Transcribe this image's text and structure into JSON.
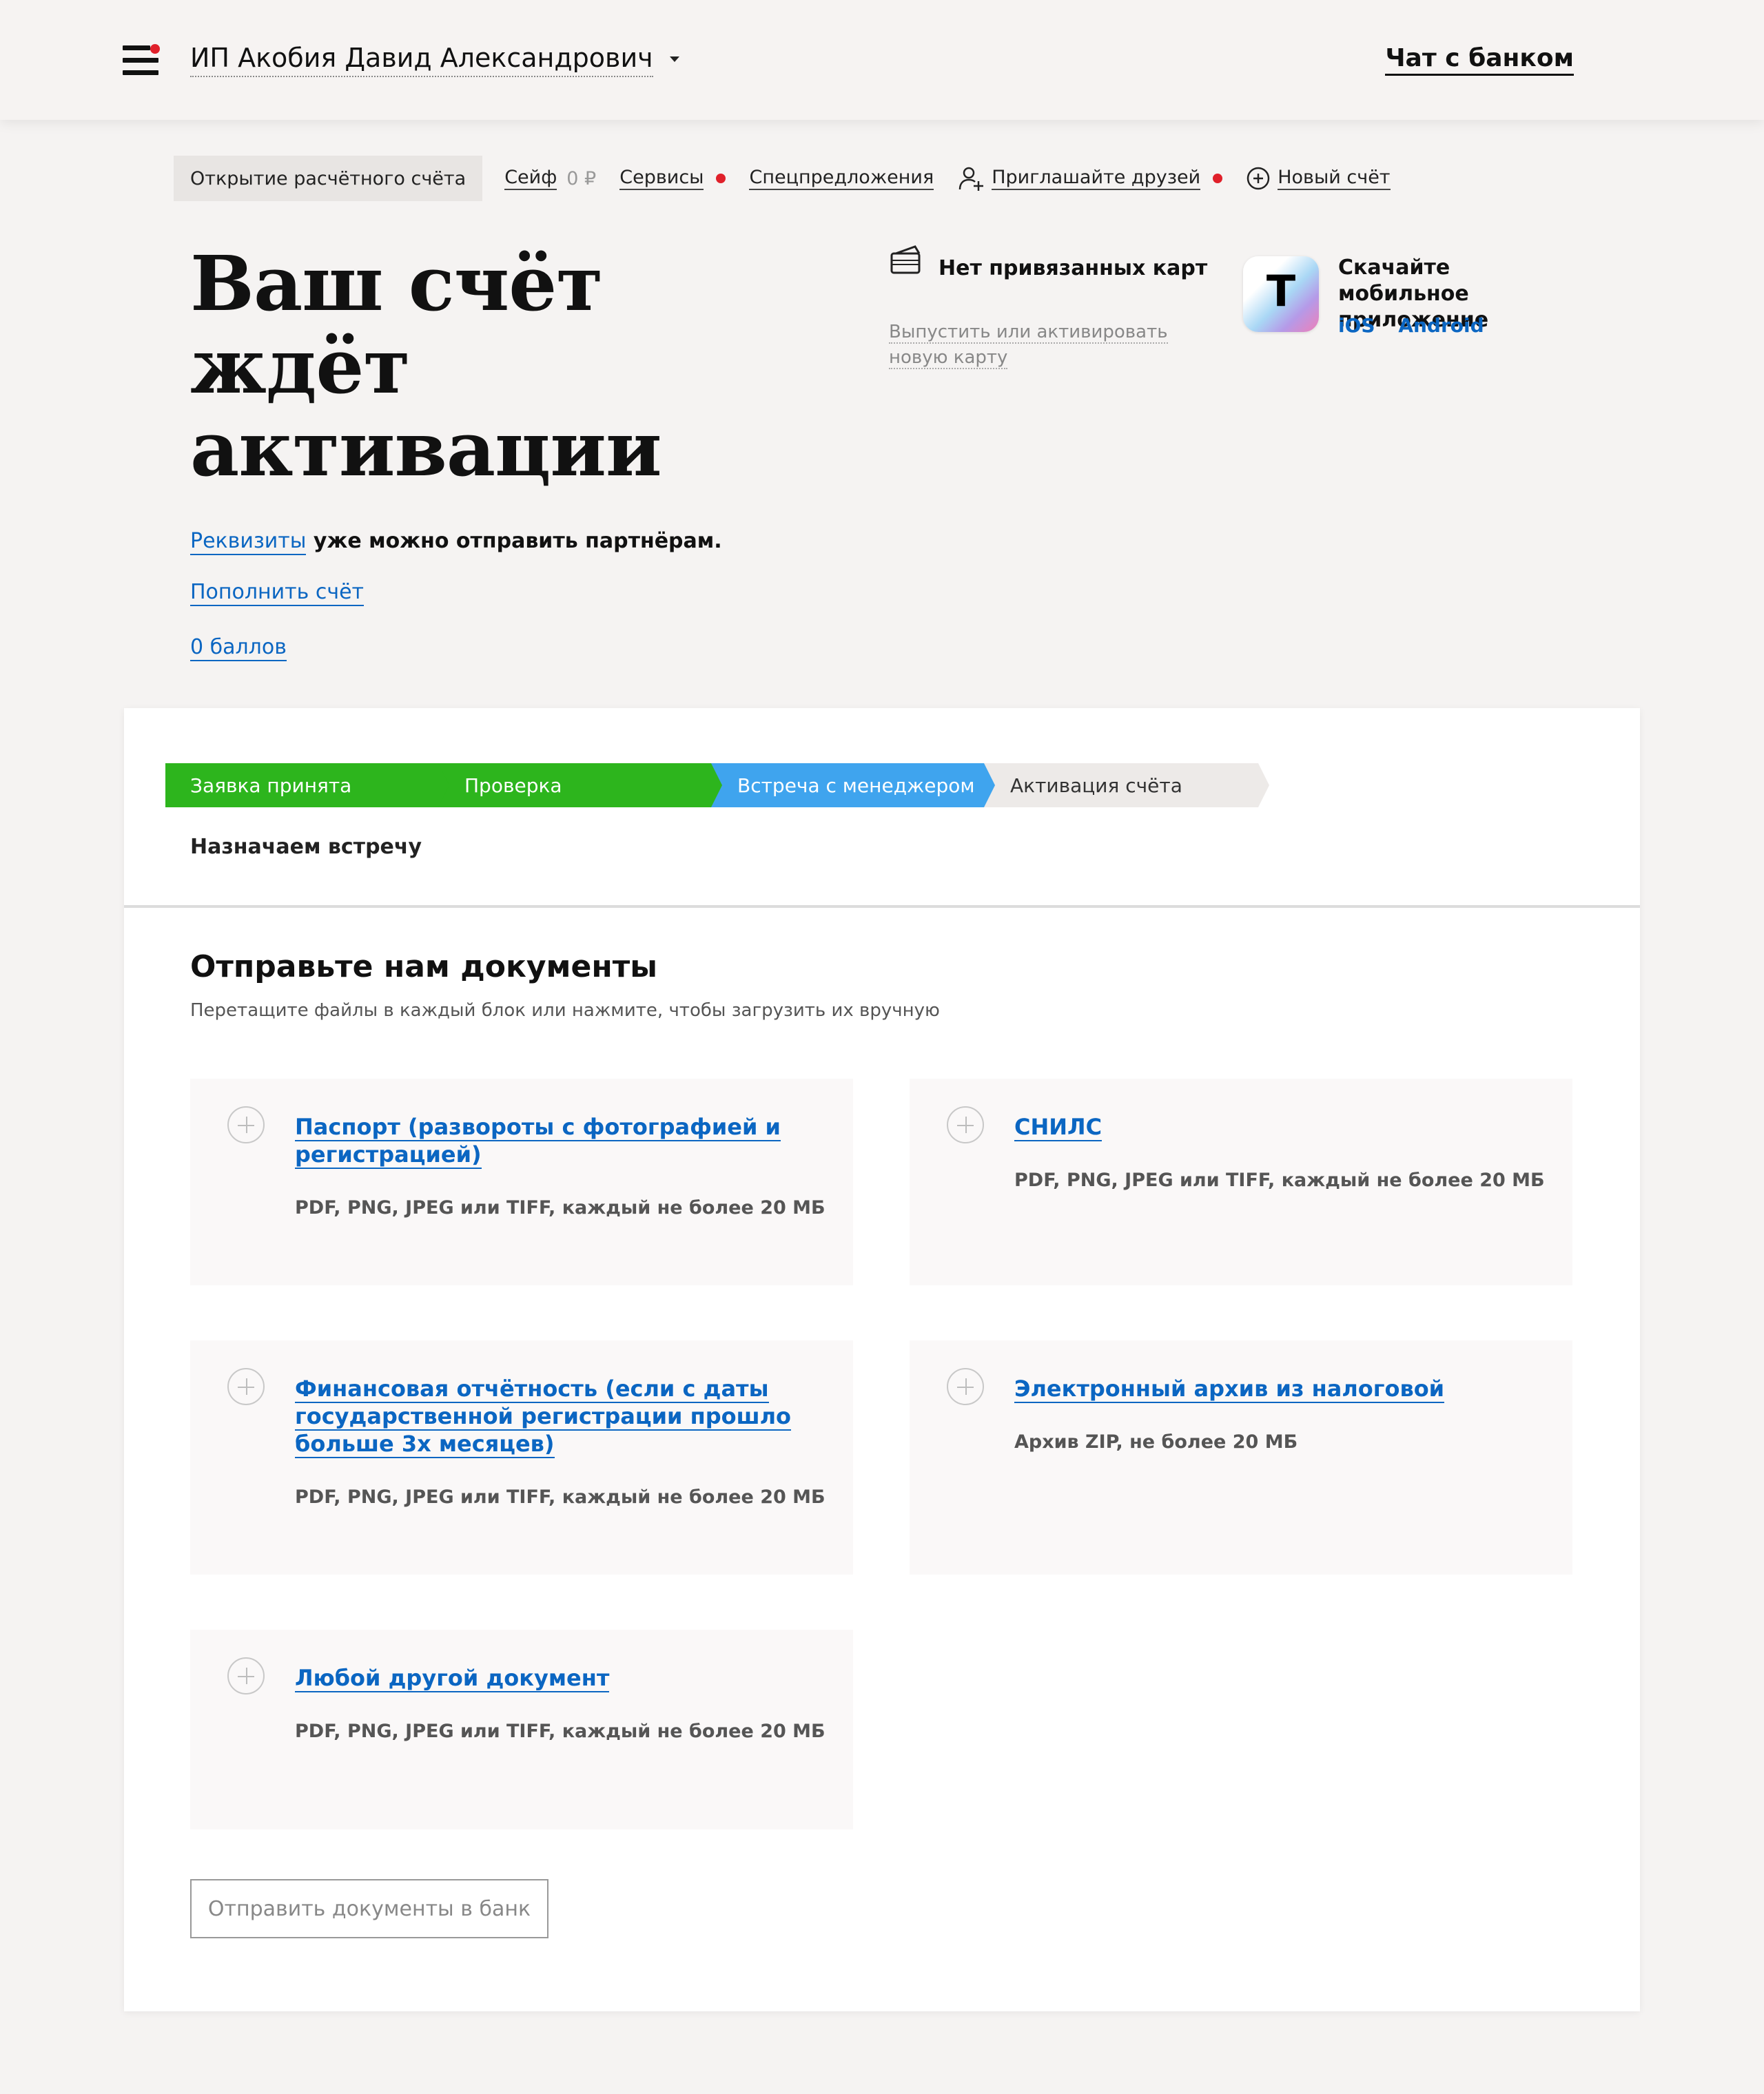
{
  "header": {
    "company": "ИП Акобия Давид Александрович",
    "chat": "Чат с банком"
  },
  "nav": {
    "items": [
      {
        "label": "Открытие расчётного счёта"
      },
      {
        "label": "Сейф",
        "extra": "0 ₽"
      },
      {
        "label": "Сервисы"
      },
      {
        "label": "Спецпредложения"
      },
      {
        "label": "Приглашайте друзей"
      },
      {
        "label": "Новый счёт"
      }
    ]
  },
  "hero": {
    "title_lines": [
      "Ваш счёт",
      "ждёт",
      "активации"
    ],
    "details_link": "Реквизиты",
    "details_text": " уже можно отправить партнёрам.",
    "topup": "Пополнить счёт",
    "points": "0 баллов"
  },
  "cards": {
    "none": "Нет привязанных карт",
    "issue": "Выпустить или активировать новую карту"
  },
  "app": {
    "icon_letter": "Т",
    "text": "Скачайте мобильное приложение",
    "ios": "iOS",
    "android": "Android"
  },
  "steps": [
    {
      "label": "Заявка принята",
      "state": "done",
      "color": "#2db51d"
    },
    {
      "label": "Проверка",
      "state": "done",
      "color": "#2db51d"
    },
    {
      "label": "Встреча с менеджером",
      "state": "current",
      "color": "#3fa4ee"
    },
    {
      "label": "Активация счёта",
      "state": "pending",
      "color": "#edeae8"
    }
  ],
  "status_note": "Назначаем встречу",
  "docs": {
    "title": "Отправьте нам документы",
    "subtitle": "Перетащите файлы в каждый блок или нажмите, чтобы загрузить их вручную",
    "items": [
      {
        "title": "Паспорт (развороты с фотографией и регистрацией)",
        "hint": "PDF, PNG, JPEG или TIFF, каждый не более 20 МБ"
      },
      {
        "title": "СНИЛС",
        "hint": "PDF, PNG, JPEG или TIFF, каждый не более 20 МБ"
      },
      {
        "title": "Финансовая отчётность (если с даты государственной регистрации прошло больше 3х месяцев)",
        "hint": "PDF, PNG, JPEG или TIFF, каждый не более 20 МБ"
      },
      {
        "title": "Электронный архив из налоговой",
        "hint": "Архив ZIP, не более 20 МБ"
      },
      {
        "title": "Любой другой документ",
        "hint": "PDF, PNG, JPEG или TIFF, каждый не более 20 МБ"
      }
    ],
    "send_button": "Отправить документы в банк"
  }
}
